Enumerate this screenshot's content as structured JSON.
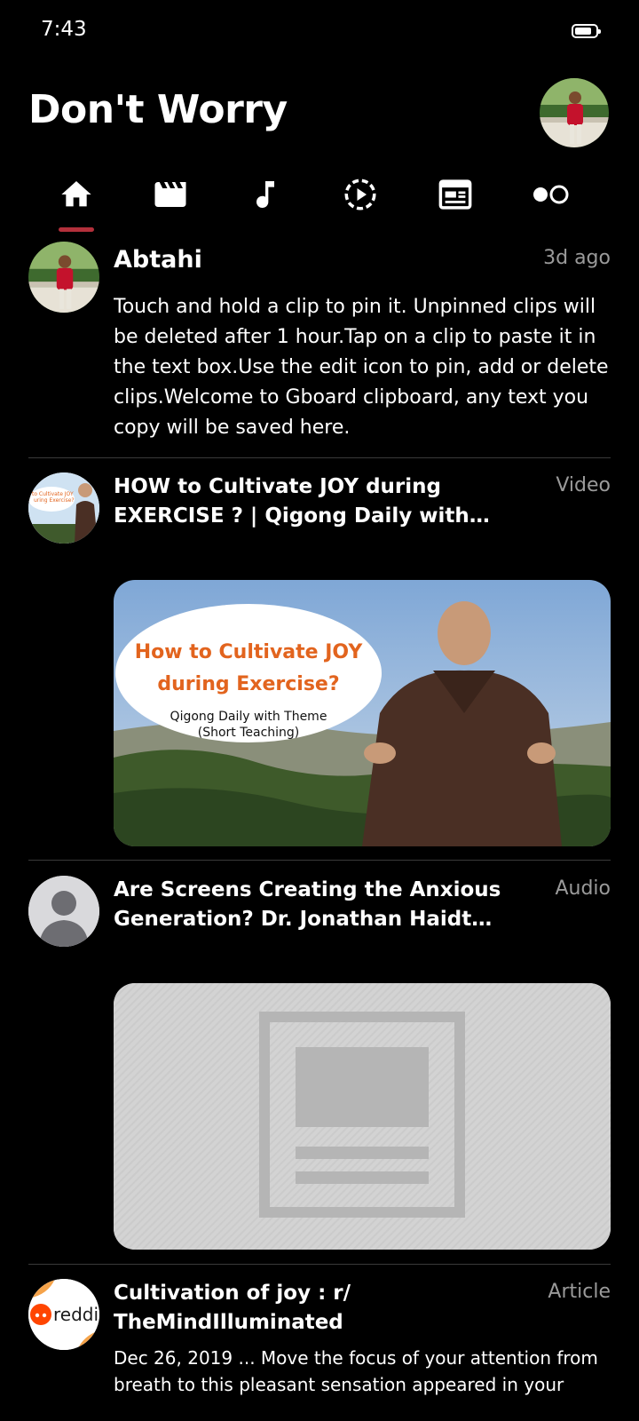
{
  "status": {
    "time": "7:43"
  },
  "app": {
    "title": "Don't Worry"
  },
  "tabs": [
    {
      "icon": "home-icon",
      "selected": true
    },
    {
      "icon": "video-clapper-icon",
      "selected": false
    },
    {
      "icon": "music-note-icon",
      "selected": false
    },
    {
      "icon": "play-circle-dashed-icon",
      "selected": false
    },
    {
      "icon": "article-icon",
      "selected": false
    },
    {
      "icon": "toggle-dots-icon",
      "selected": false
    }
  ],
  "colors": {
    "accent": "#b3303b",
    "background": "#000000",
    "meta": "#9a9a9a"
  },
  "feed": [
    {
      "title": "Abtahi",
      "meta": "3d ago",
      "text": "Touch and hold a clip to pin it. Unpinned clips will be deleted after 1 hour.Tap on a clip to paste it in the text box.Use the edit icon to pin, add or delete clips.Welcome to Gboard clipboard, any text you copy will be saved here."
    },
    {
      "title": "HOW to Cultivate JOY during EXERCISE ? | Qigong Daily with Theme (Short Teaching)",
      "meta": "Video",
      "thumb_line1": "How to Cultivate JOY",
      "thumb_line2": "during Exercise?",
      "thumb_line3": "Qigong Daily with Theme",
      "thumb_line4": "(Short Teaching)",
      "avatar_line1": "to Cultivate JOY",
      "avatar_line2": "uring Exercise?"
    },
    {
      "title": "Are Screens Creating the Anxious Generation? Dr. Jonathan Haidt Weighs In",
      "meta": "Audio"
    },
    {
      "title": "Cultivation of joy : r/ TheMindIlluminated",
      "meta": "Article",
      "text": "Dec 26, 2019 ... Move the focus of your attention from breath to this pleasant sensation appeared in your",
      "avatar_text": "reddi"
    }
  ]
}
